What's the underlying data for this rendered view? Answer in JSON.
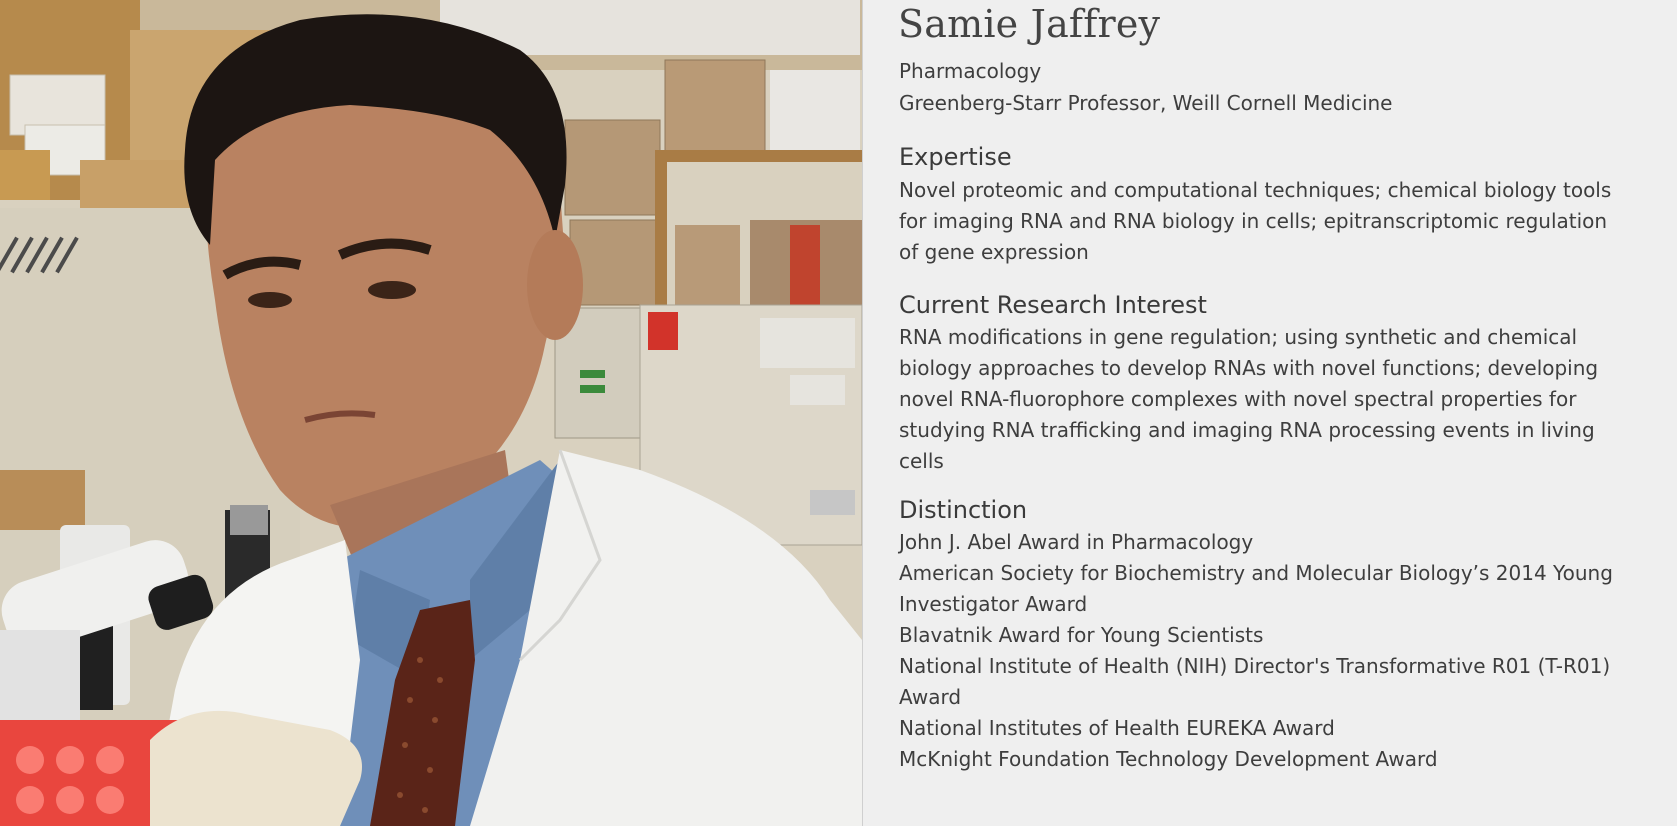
{
  "profile": {
    "name": "Samie Jaffrey",
    "department": "Pharmacology",
    "title": "Greenberg-Starr Professor, Weill Cornell Medicine"
  },
  "expertise": {
    "heading": "Expertise",
    "lines": [
      "Novel proteomic and computational techniques; chemical biology tools",
      "for imaging RNA and RNA biology in cells; epitranscriptomic regulation",
      "of gene expression"
    ]
  },
  "research": {
    "heading": "Current Research Interest",
    "lines": [
      "RNA modifications in gene regulation; using synthetic and chemical",
      "biology approaches to develop RNAs with novel functions; developing",
      "novel RNA-fluorophore complexes with novel spectral properties for",
      "studying RNA trafficking and imaging RNA processing events in living",
      "cells"
    ]
  },
  "distinction": {
    "heading": "Distinction",
    "lines": [
      "John J. Abel Award in Pharmacology",
      "American Society for Biochemistry and Molecular Biology’s 2014 Young",
      "Investigator Award",
      "Blavatnik Award for Young Scientists",
      "National Institute of Health (NIH) Director's Transformative R01 (T-R01)",
      "Award",
      "National Institutes of Health EUREKA Award",
      "McKnight Foundation Technology Development Award"
    ]
  },
  "colors": {
    "panel_bg": "#efefef",
    "text": "#3e3e3e",
    "lab_coat": "#f4f4f2",
    "shirt": "#6f8fb9",
    "tie": "#5a2418"
  }
}
